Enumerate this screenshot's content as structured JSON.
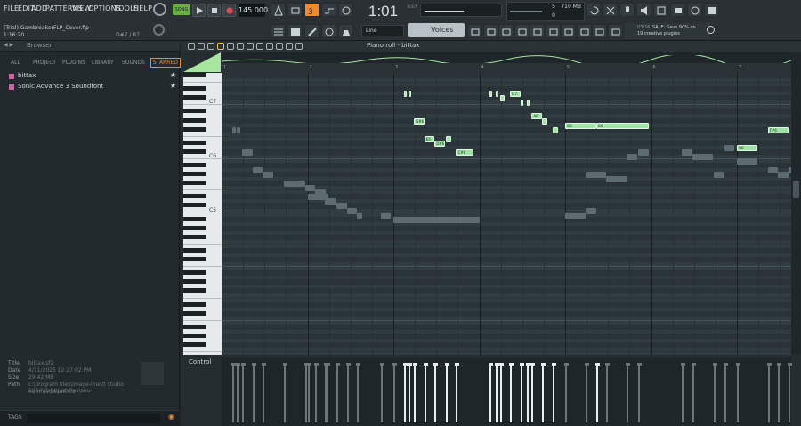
{
  "menu": [
    "FILE",
    "EDIT",
    "ADD",
    "PATTERNS",
    "VIEW",
    "OPTIONS",
    "TOOLS",
    "HELP"
  ],
  "transport": {
    "mode": "SONG",
    "tempo": "145.000",
    "time": "1:01",
    "time_sub": "00",
    "time_unit": "B:S:T",
    "cpu": "5",
    "memory": "710 MB",
    "voices_count": "0"
  },
  "project": {
    "title": "(Trial) GambreakerFLP_Cover.flp",
    "time": "1:16:20",
    "pattern_pos": "D#7 / 87"
  },
  "toolbar": {
    "snap": "Line",
    "channel_selector": "Voices"
  },
  "news": {
    "date": "03/26",
    "line1": "SALE: Save 90% on",
    "line2": "19 creative plugins"
  },
  "browser": {
    "title": "Browser",
    "tabs": [
      "ALL",
      "PROJECT",
      "PLUGINS",
      "LIBRARY",
      "SOUNDS",
      "STARRED"
    ],
    "active_tab": "STARRED",
    "items": [
      {
        "label": "bittax",
        "color": "#d35fa3"
      },
      {
        "label": "Sonic Advance 3 Soundfont",
        "color": "#d35fa3"
      }
    ],
    "info": [
      {
        "label": "Title",
        "value": "bittax.sf2"
      },
      {
        "label": "Date",
        "value": "4/11/2025 12:27:02 PM"
      },
      {
        "label": "Size",
        "value": "29.42 MB"
      },
      {
        "label": "Path",
        "value": "c:\\program files\\image-line\\fl studio 2024\\data\\patches\\sou-"
      },
      {
        "label": "",
        "value": "ndfonts\\bittax.sf2"
      }
    ],
    "footer_tag": "TAGS"
  },
  "piano_roll": {
    "title": "Piano roll - bittax",
    "control_label": "Control",
    "bars": [
      "1",
      "2",
      "3",
      "4",
      "5",
      "6",
      "7"
    ],
    "key_labels": [
      "C7",
      "C6",
      "C5"
    ]
  },
  "notes": [
    {
      "label": "",
      "bar": 2.12,
      "len": 0.03,
      "pitch": 86
    },
    {
      "label": "",
      "bar": 2.18,
      "len": 0.03,
      "pitch": 86
    },
    {
      "label": "",
      "bar": 3.12,
      "len": 0.03,
      "pitch": 86
    },
    {
      "label": "",
      "bar": 3.19,
      "len": 0.03,
      "pitch": 86
    },
    {
      "label": "D7",
      "bar": 3.36,
      "len": 0.12,
      "pitch": 86
    },
    {
      "label": "",
      "bar": 3.24,
      "len": 0.06,
      "pitch": 85
    },
    {
      "label": "",
      "bar": 3.48,
      "len": 0.03,
      "pitch": 84
    },
    {
      "label": "",
      "bar": 3.55,
      "len": 0.03,
      "pitch": 84
    },
    {
      "label": "A6",
      "bar": 3.61,
      "len": 0.12,
      "pitch": 81
    },
    {
      "label": "G#6",
      "bar": 2.24,
      "len": 0.12,
      "pitch": 80
    },
    {
      "label": "",
      "bar": 3.73,
      "len": 0.06,
      "pitch": 80
    },
    {
      "label": "G6",
      "bar": 4.0,
      "len": 0.36,
      "pitch": 79
    },
    {
      "label": "G6",
      "bar": 4.36,
      "len": 0.61,
      "pitch": 79
    },
    {
      "label": "",
      "bar": 3.86,
      "len": 0.06,
      "pitch": 78
    },
    {
      "label": "F#6",
      "bar": 6.36,
      "len": 0.24,
      "pitch": 78
    },
    {
      "label": "E6",
      "bar": 2.36,
      "len": 0.12,
      "pitch": 76
    },
    {
      "label": "",
      "bar": 2.61,
      "len": 0.06,
      "pitch": 76
    },
    {
      "label": "D#6",
      "bar": 2.48,
      "len": 0.12,
      "pitch": 75
    },
    {
      "label": "D6",
      "bar": 6.0,
      "len": 0.24,
      "pitch": 74
    },
    {
      "label": "C#6",
      "bar": 2.73,
      "len": 0.2,
      "pitch": 73
    }
  ],
  "ghost_notes": [
    {
      "bar": 0.12,
      "len": 0.03,
      "pitch": 78
    },
    {
      "bar": 0.18,
      "len": 0.03,
      "pitch": 78
    },
    {
      "bar": 0.24,
      "len": 0.12,
      "pitch": 73
    },
    {
      "bar": 0.36,
      "len": 0.12,
      "pitch": 69
    },
    {
      "bar": 0.48,
      "len": 0.12,
      "pitch": 68
    },
    {
      "bar": 0.73,
      "len": 0.24,
      "pitch": 66
    },
    {
      "bar": 0.97,
      "len": 0.12,
      "pitch": 65
    },
    {
      "bar": 1.09,
      "len": 0.12,
      "pitch": 64
    },
    {
      "bar": 1.22,
      "len": 0.12,
      "pitch": 62
    },
    {
      "bar": 1.34,
      "len": 0.12,
      "pitch": 61
    },
    {
      "bar": 1.46,
      "len": 0.12,
      "pitch": 60
    },
    {
      "bar": 1.58,
      "len": 0.06,
      "pitch": 59
    },
    {
      "bar": 1.0,
      "len": 0.24,
      "pitch": 63
    },
    {
      "bar": 1.2,
      "len": 0.12,
      "pitch": 62
    },
    {
      "bar": 1.85,
      "len": 0.12,
      "pitch": 59
    },
    {
      "bar": 2.0,
      "len": 1.0,
      "pitch": 58
    },
    {
      "bar": 4.0,
      "len": 0.24,
      "pitch": 59
    },
    {
      "bar": 4.24,
      "len": 0.12,
      "pitch": 60
    },
    {
      "bar": 4.24,
      "len": 0.24,
      "pitch": 68
    },
    {
      "bar": 4.48,
      "len": 0.24,
      "pitch": 67
    },
    {
      "bar": 4.72,
      "len": 0.12,
      "pitch": 72
    },
    {
      "bar": 4.85,
      "len": 0.12,
      "pitch": 73
    },
    {
      "bar": 5.36,
      "len": 0.12,
      "pitch": 73
    },
    {
      "bar": 5.48,
      "len": 0.24,
      "pitch": 72
    },
    {
      "bar": 5.73,
      "len": 0.12,
      "pitch": 68
    },
    {
      "bar": 6.0,
      "len": 0.24,
      "pitch": 71
    },
    {
      "bar": 6.36,
      "len": 0.12,
      "pitch": 69
    },
    {
      "bar": 6.48,
      "len": 0.12,
      "pitch": 68
    },
    {
      "bar": 6.6,
      "len": 0.06,
      "pitch": 69
    },
    {
      "bar": 5.85,
      "len": 0.12,
      "pitch": 74
    }
  ],
  "colors": {
    "accent_orange": "#f08a2b",
    "note_green": "#9fe3a6",
    "keyboard_green": "#a8e6a0"
  }
}
